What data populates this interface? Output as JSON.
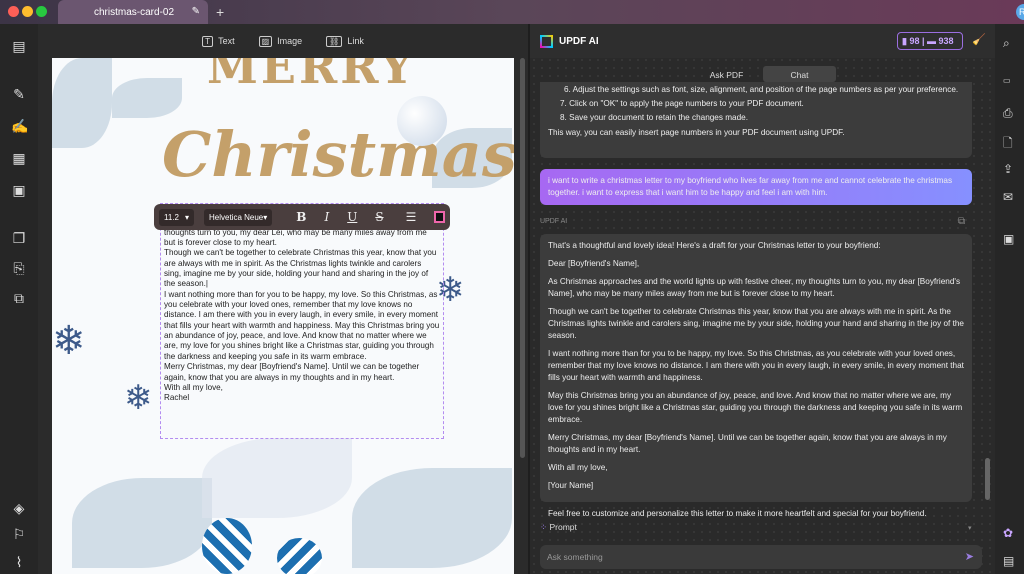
{
  "window": {
    "tab_title": "christmas-card-02",
    "avatar": "R"
  },
  "editor_toolbar": {
    "text": "Text",
    "image": "Image",
    "link": "Link"
  },
  "page": {
    "merry": "MERRY",
    "christmas": "Christmas"
  },
  "format_bar": {
    "font_size": "11.2",
    "font_family": "Helvetica Neue",
    "bold": "B",
    "italic": "I",
    "underline": "U",
    "strike": "S"
  },
  "letter_text": "Dear Lei,\nAs Christmas approaches and the world lights up with festive cheer, my thoughts turn to you, my dear Lei, who may be many miles away from me but is forever close to my heart.\nThough we can't be together to celebrate Christmas this year, know that you are always with me in spirit. As the Christmas lights twinkle and carolers sing, imagine me by your side, holding your hand and sharing in the joy of the season.|\nI want nothing more than for you to be happy, my love. So this Christmas, as you celebrate with your loved ones, remember that my love knows no distance. I am there with you in every laugh, in every smile, in every moment that fills your heart with warmth and happiness. May this Christmas bring you an abundance of joy, peace, and love. And know that no matter where we are, my love for you shines bright like a Christmas star, guiding you through the darkness and keeping you safe in its warm embrace.\nMerry Christmas, my dear [Boyfriend's Name]. Until we can be together again, know that you are always in my thoughts and in my heart.\nWith all my love,\nRachel",
  "ai": {
    "title": "UPDF AI",
    "credits_pdf": "98",
    "credits_chat": "938",
    "tabs": [
      "Ask PDF",
      "Chat"
    ],
    "prev_steps": [
      "6. Adjust the settings such as font, size, alignment, and position of the page numbers as per your preference.",
      "7.  Click on \"OK\" to apply the page numbers to your PDF document.",
      "8.  Save your document to retain the changes made."
    ],
    "prev_summary": "This way, you can easily insert page numbers in your PDF document using UPDF.",
    "user_msg": "i want to write a christmas letter to my boyfriend who lives far away from me and cannot celebrate the christmas together. i want to express that i want him to be happy and feel i am with him.",
    "bot_label": "UPDF AI",
    "bot_paragraphs": [
      "That's a thoughtful and lovely idea! Here's a draft for your Christmas letter to your boyfriend:",
      "Dear [Boyfriend's Name],",
      "As Christmas approaches and the world lights up with festive cheer, my thoughts turn to you, my dear [Boyfriend's Name], who may be many miles away from me but is forever close to my heart.",
      "Though we can't be together to celebrate Christmas this year, know that you are always with me in spirit. As the Christmas lights twinkle and carolers sing, imagine me by your side, holding your hand and sharing in the joy of the season.",
      "I want nothing more than for you to be happy, my love. So this Christmas, as you celebrate with your loved ones, remember that my love knows no distance. I am there with you in every laugh, in every smile, in every moment that fills your heart with warmth and happiness.",
      "May this Christmas bring you an abundance of joy, peace, and love. And know that no matter where we are, my love for you shines bright like a Christmas star, guiding you through the darkness and keeping you safe in its warm embrace.",
      "Merry Christmas, my dear [Boyfriend's Name]. Until we can be together again, know that you are always in my thoughts and in my heart.",
      "With all my love,",
      "[Your Name]",
      "Feel free to customize and personalize this letter to make it more heartfelt and special for your boyfriend."
    ],
    "prompt_label": "Prompt",
    "input_placeholder": "Ask something"
  }
}
